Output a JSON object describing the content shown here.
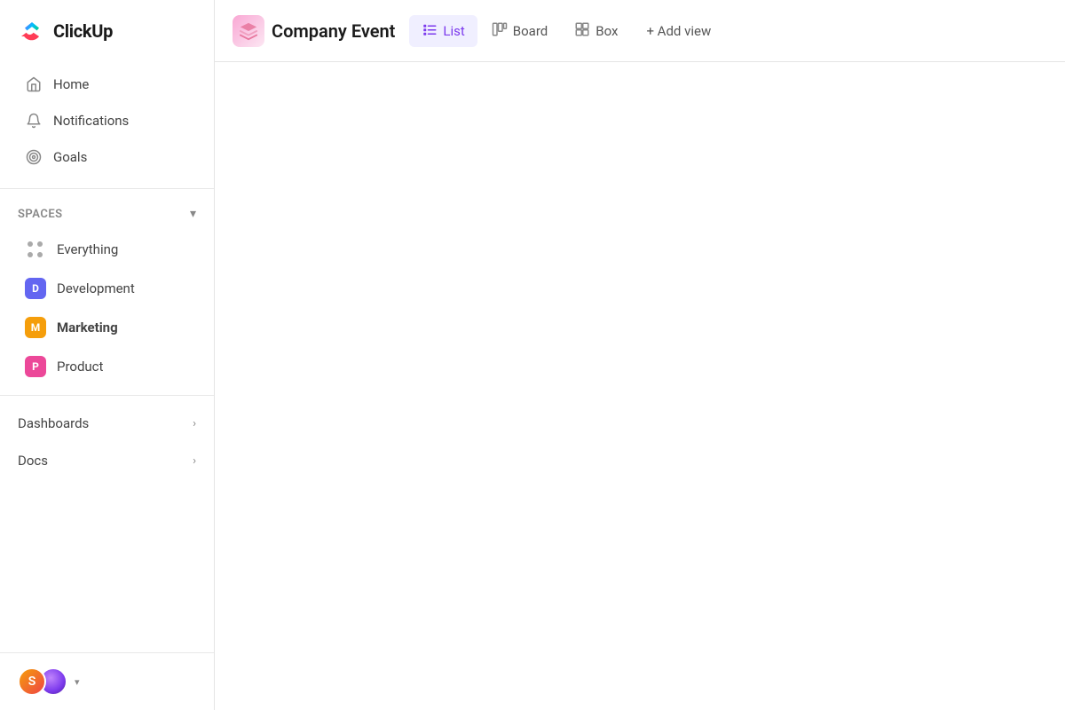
{
  "logo": {
    "text": "ClickUp"
  },
  "sidebar": {
    "nav": [
      {
        "id": "home",
        "label": "Home",
        "icon": "home"
      },
      {
        "id": "notifications",
        "label": "Notifications",
        "icon": "bell"
      },
      {
        "id": "goals",
        "label": "Goals",
        "icon": "goals"
      }
    ],
    "spaces_label": "Spaces",
    "spaces": [
      {
        "id": "everything",
        "label": "Everything",
        "type": "dots"
      },
      {
        "id": "development",
        "label": "Development",
        "type": "avatar",
        "color": "#6366f1",
        "letter": "D"
      },
      {
        "id": "marketing",
        "label": "Marketing",
        "type": "avatar",
        "color": "#f59e0b",
        "letter": "M",
        "bold": true
      },
      {
        "id": "product",
        "label": "Product",
        "type": "avatar",
        "color": "#ec4899",
        "letter": "P"
      }
    ],
    "dashboards_label": "Dashboards",
    "docs_label": "Docs"
  },
  "header": {
    "project_icon": "📦",
    "project_title": "Company Event",
    "tabs": [
      {
        "id": "list",
        "label": "List",
        "icon": "list",
        "active": true
      },
      {
        "id": "board",
        "label": "Board",
        "icon": "board"
      },
      {
        "id": "box",
        "label": "Box",
        "icon": "box"
      }
    ],
    "add_view_label": "+ Add view"
  }
}
